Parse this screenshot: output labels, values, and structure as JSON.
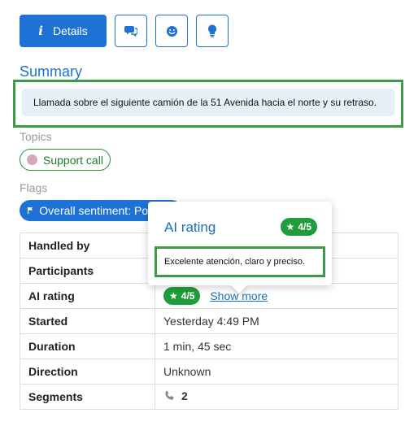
{
  "toolbar": {
    "details_label": "Details",
    "icons": [
      "info-icon",
      "chat-icon",
      "smiley-icon",
      "lightbulb-icon"
    ]
  },
  "summary": {
    "title": "Summary",
    "text": "Llamada sobre el siguiente camión de la 51 Avenida hacia el norte y su retraso."
  },
  "topics": {
    "label": "Topics",
    "items": [
      "Support call"
    ]
  },
  "flags": {
    "label": "Flags",
    "items": [
      "Overall sentiment: Positive"
    ]
  },
  "details_table": {
    "rows": [
      {
        "key": "Handled by",
        "value": ""
      },
      {
        "key": "Participants",
        "value": ""
      },
      {
        "key": "AI rating",
        "value": "4/5",
        "link": "Show more"
      },
      {
        "key": "Started",
        "value": "Yesterday 4:49 PM"
      },
      {
        "key": "Duration",
        "value": "1 min, 45 sec"
      },
      {
        "key": "Direction",
        "value": "Unknown"
      },
      {
        "key": "Segments",
        "value": "2"
      }
    ]
  },
  "popover": {
    "title": "AI rating",
    "rating": "4/5",
    "text": "Excelente atención, claro y preciso."
  },
  "colors": {
    "primary": "#1e72d6",
    "rating_green": "#1f9d3c",
    "highlight_frame": "#3d9a47",
    "summary_bg": "#e7f0f8"
  }
}
